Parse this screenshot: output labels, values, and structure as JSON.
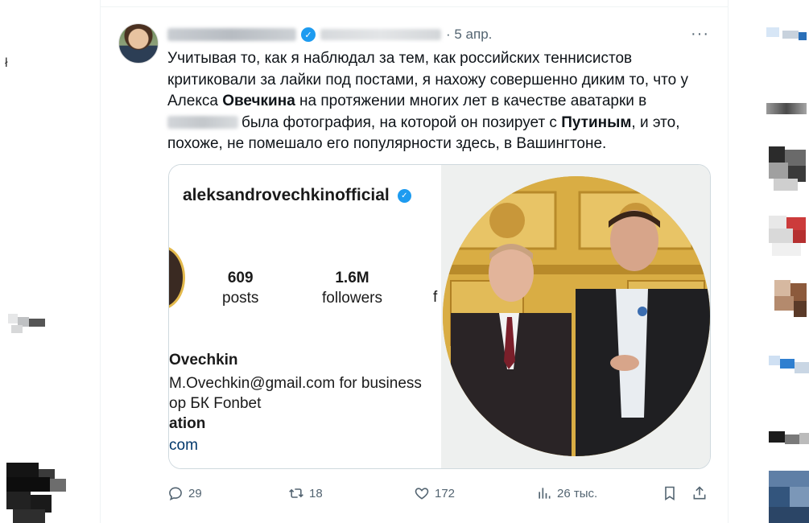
{
  "tweet": {
    "time": "· 5 апр.",
    "more_label": "···",
    "text": {
      "p1": "Учитывая то, как я наблюдал за тем, как российских теннисистов критиковали за лайки под постами, я нахожу совершенно диким то, что у Алекса ",
      "b1": "Овечкина",
      "p2": " на протяжении многих лет в качестве аватарки в ",
      "p3": "была фотография, на которой он позирует с ",
      "b2": "Путиным",
      "p4": ", и это, похоже, не помешало его популярности здесь, в Вашингтоне."
    },
    "media": {
      "username": "aleksandrovechkinofficial",
      "posts_count": "609",
      "posts_label": "posts",
      "followers_count": "1.6M",
      "followers_label": "followers",
      "following_partial": "f",
      "bio_name": "Ovechkin",
      "bio_email": "M.Ovechkin@gmail.com for business",
      "bio_sponsor": "ор БК Fonbet",
      "bio_category": "ation",
      "bio_link": "com"
    },
    "actions": {
      "replies": "29",
      "retweets": "18",
      "likes": "172",
      "views": "26 тыс."
    }
  },
  "left_glyph": "ł",
  "colors": {
    "accent": "#1d9bf0",
    "text_primary": "#0f1419",
    "text_secondary": "#536471",
    "border": "#cfd9de"
  }
}
